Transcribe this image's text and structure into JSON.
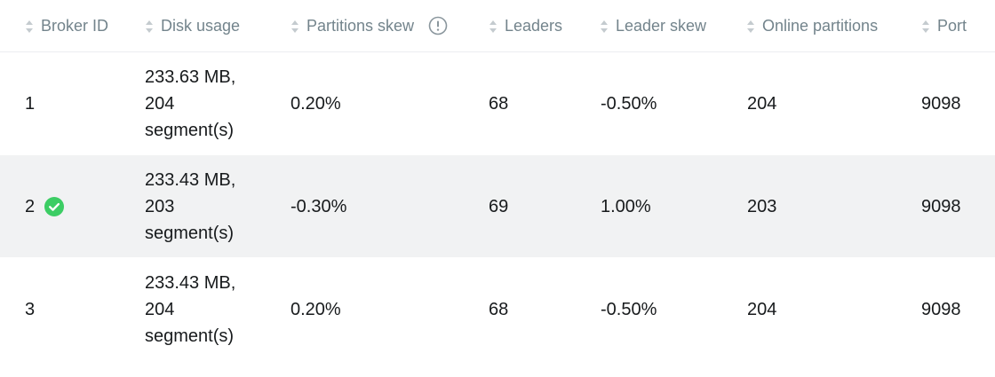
{
  "table": {
    "columns": [
      {
        "label": "Broker ID",
        "sortable": true
      },
      {
        "label": "Disk usage",
        "sortable": true
      },
      {
        "label": "Partitions skew",
        "sortable": true,
        "info_icon": "info-icon"
      },
      {
        "label": "Leaders",
        "sortable": true
      },
      {
        "label": "Leader skew",
        "sortable": true
      },
      {
        "label": "Online partitions",
        "sortable": true
      },
      {
        "label": "Port",
        "sortable": true
      }
    ],
    "rows": [
      {
        "broker_id": "1",
        "controller": false,
        "disk_size": "233.63 MB,",
        "disk_segments_count": "204",
        "disk_segments_label": "segment(s)",
        "partitions_skew": "0.20%",
        "leaders": "68",
        "leader_skew": "-0.50%",
        "online_partitions": "204",
        "port": "9098"
      },
      {
        "broker_id": "2",
        "controller": true,
        "disk_size": "233.43 MB,",
        "disk_segments_count": "203",
        "disk_segments_label": "segment(s)",
        "partitions_skew": "-0.30%",
        "leaders": "69",
        "leader_skew": "1.00%",
        "online_partitions": "203",
        "port": "9098"
      },
      {
        "broker_id": "3",
        "controller": false,
        "disk_size": "233.43 MB,",
        "disk_segments_count": "204",
        "disk_segments_label": "segment(s)",
        "partitions_skew": "0.20%",
        "leaders": "68",
        "leader_skew": "-0.50%",
        "online_partitions": "204",
        "port": "9098"
      }
    ]
  },
  "colors": {
    "header_text": "#73848c",
    "cell_text": "#171a1c",
    "alt_row_bg": "#f1f2f3",
    "controller_icon": "#3ccd64"
  }
}
